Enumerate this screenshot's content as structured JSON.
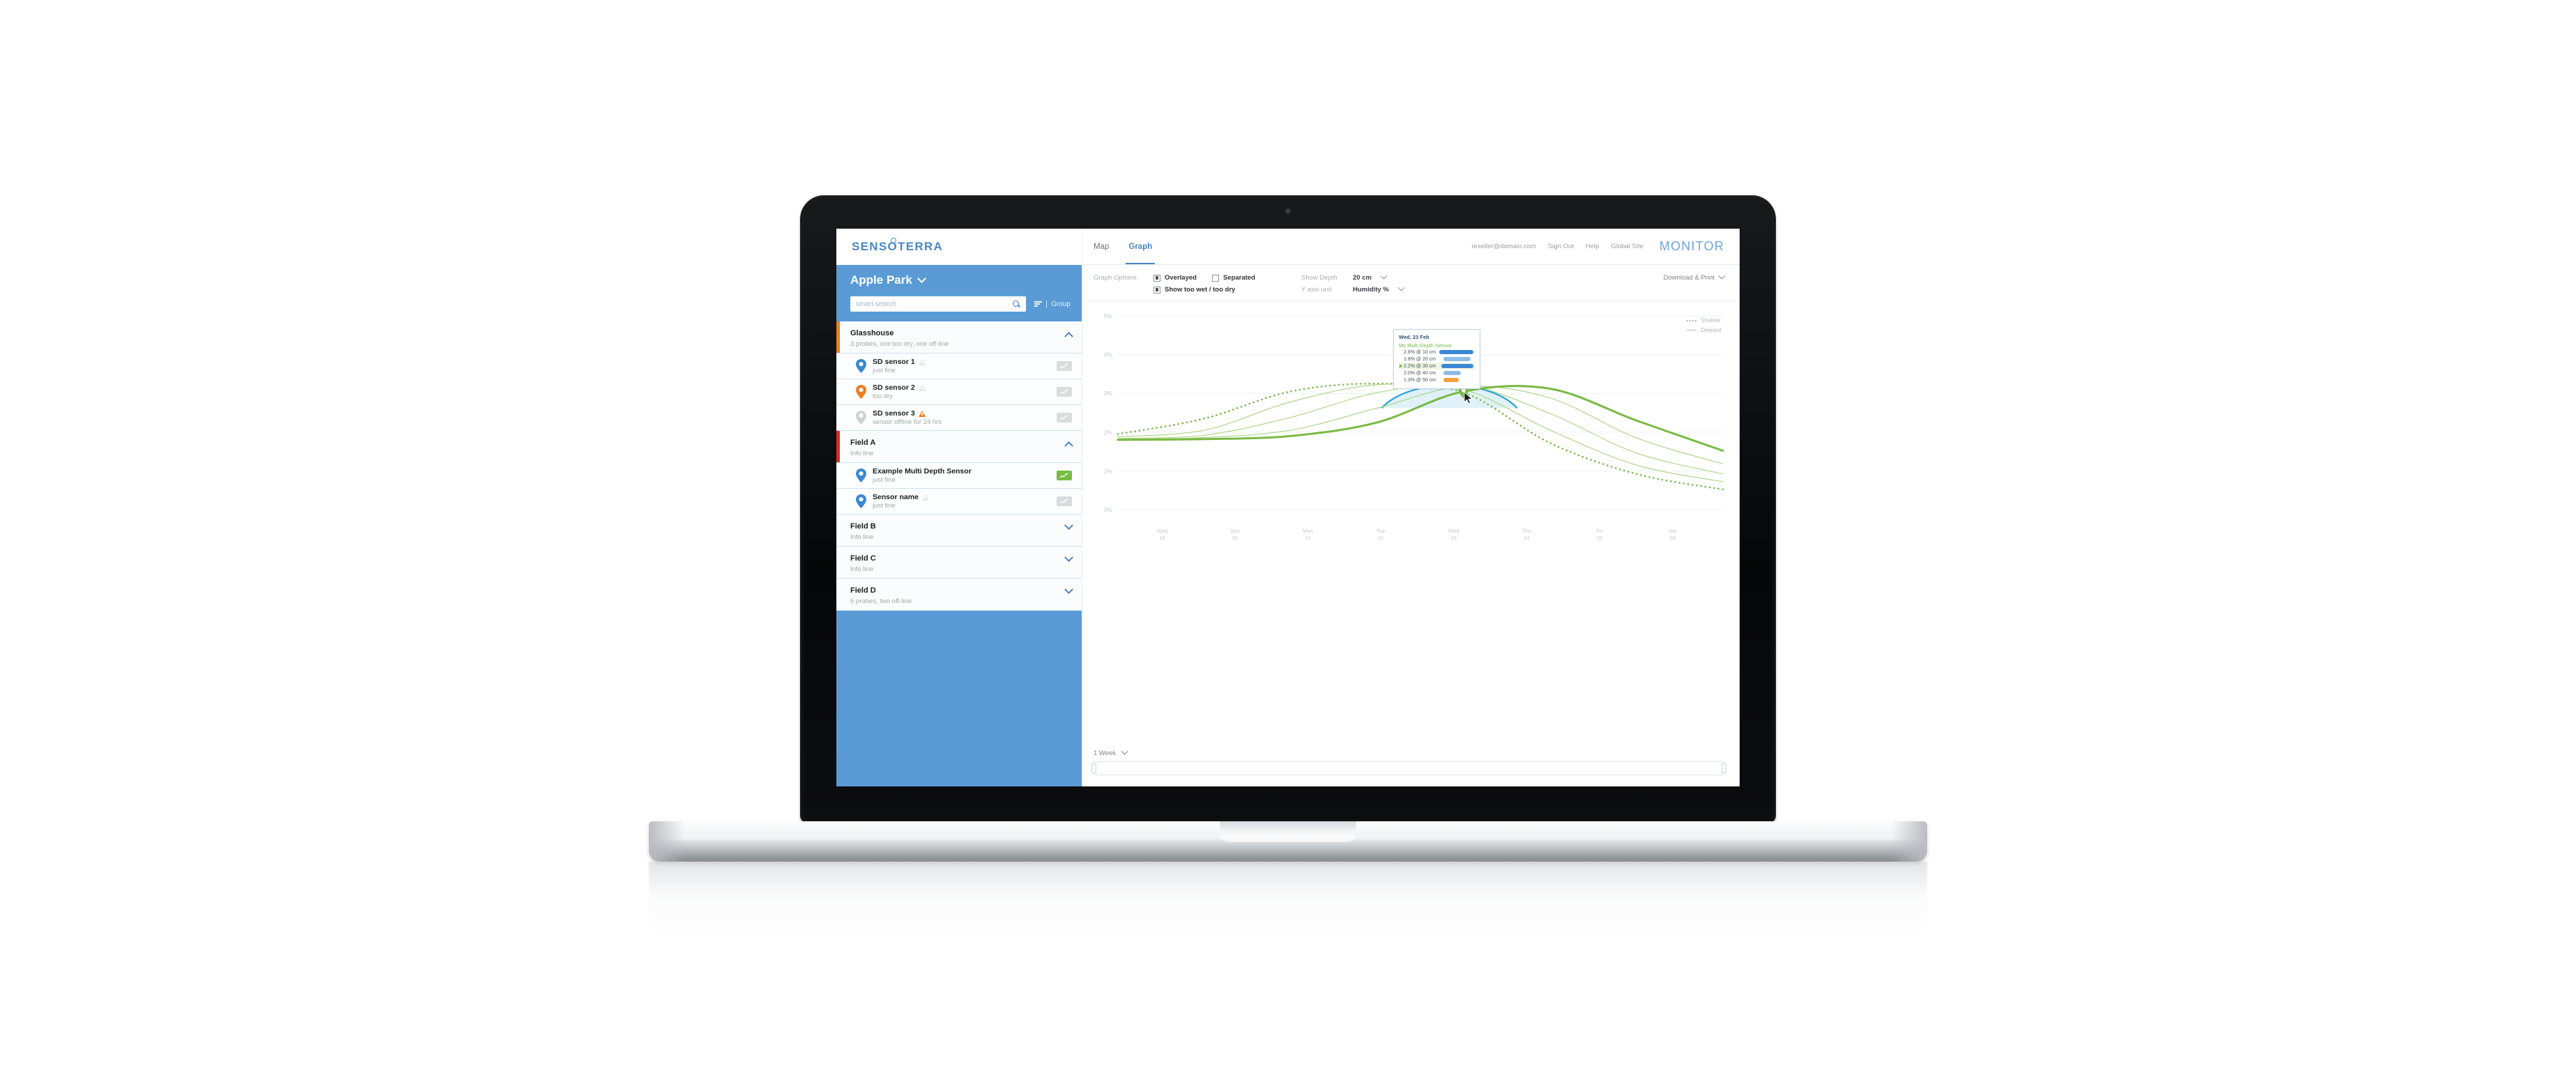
{
  "brand": {
    "name_part1": "SENS",
    "name_o": "O",
    "name_part2": "TERRA"
  },
  "sidebar": {
    "farm_title": "Apple Park",
    "search_placeholder": "smart search",
    "group_button": "Group",
    "groups": [
      {
        "name": "Glasshouse",
        "info": "3 probes, one too dry, one off-line",
        "expanded": true,
        "accent": "#f07d1e",
        "sensors": [
          {
            "name": "SD sensor 1",
            "status": "just fine",
            "pin_color": "#3b87d4",
            "warn": "muted",
            "badge": "inactive"
          },
          {
            "name": "SD sensor 2",
            "status": "too dry",
            "pin_color": "#f07d1e",
            "warn": "muted",
            "badge": "inactive"
          },
          {
            "name": "SD sensor 3",
            "status": "sensor offline for 24 hrs",
            "pin_color": "#cfd3d6",
            "warn": "alert",
            "badge": "inactive"
          }
        ]
      },
      {
        "name": "Field A",
        "info": "Info line",
        "expanded": true,
        "accent": "#e02b20",
        "sensors": [
          {
            "name": "Example Multi Depth Sensor",
            "status": "just fine",
            "pin_color": "#3b87d4",
            "warn": "none",
            "badge": "active"
          },
          {
            "name": "Sensor name",
            "status": "just fine",
            "pin_color": "#3b87d4",
            "warn": "muted",
            "badge": "inactive"
          }
        ]
      },
      {
        "name": "Field B",
        "info": "Info line",
        "expanded": false,
        "accent": "transparent",
        "sensors": []
      },
      {
        "name": "Field C",
        "info": "Info line",
        "expanded": false,
        "accent": "transparent",
        "sensors": []
      },
      {
        "name": "Field D",
        "info": "6 probes, two off-line",
        "expanded": false,
        "accent": "transparent",
        "sensors": []
      }
    ]
  },
  "topnav": {
    "tabs": [
      {
        "label": "Map",
        "active": false
      },
      {
        "label": "Graph",
        "active": true
      }
    ],
    "user_email": "reseller@domain.com",
    "sign_out": "Sign Out",
    "help": "Help",
    "global_site": "Global Site",
    "product": "MONITOR"
  },
  "options": {
    "graph_options_label": "Graph Options",
    "overlayed": "Overlayed",
    "separated": "Separated",
    "show_too_wet_too_dry": "Show too wet / too dry",
    "show_depth_label": "Show Depth",
    "show_depth_value": "20 cm",
    "y_axis_unit_label": "Y axis unit",
    "y_axis_unit_value": "Humidity %",
    "download_print": "Download & Print"
  },
  "chart_data": {
    "type": "line",
    "title": "",
    "xlabel": "",
    "ylabel": "Humidity %",
    "ylim": [
      0,
      5
    ],
    "grid": true,
    "legend_position": "right",
    "y_ticks": [
      "0%",
      "1%",
      "2%",
      "3%",
      "4%",
      "5%"
    ],
    "x": [
      "Wed 16",
      "Sun 20",
      "Mon 21",
      "Tue 22",
      "Wed 23",
      "Thu 24",
      "Fri 25",
      "Sat 26"
    ],
    "x_tick_days": [
      "Wed",
      "Sun",
      "Mon",
      "Tue",
      "Wed",
      "Thu",
      "Fri",
      "Sat"
    ],
    "x_tick_dates": [
      "16",
      "20",
      "21",
      "22",
      "23",
      "24",
      "25",
      "26"
    ],
    "legend": [
      {
        "name": "Shallow",
        "style": "dotted"
      },
      {
        "name": "Deepest",
        "style": "solid"
      }
    ],
    "series": [
      {
        "name": "10 cm",
        "style": "dotted",
        "color": "#7ab648",
        "width": 2.6,
        "values": [
          1.95,
          2.35,
          3.05,
          3.25,
          3.02,
          1.72,
          0.92,
          0.52
        ]
      },
      {
        "name": "20 cm",
        "style": "solid",
        "color": "#a9d47f",
        "width": 1.1,
        "values": [
          1.88,
          2.05,
          2.78,
          3.22,
          3.1,
          2.05,
          1.15,
          0.72
        ]
      },
      {
        "name": "30 cm",
        "style": "solid",
        "color": "#a9d47f",
        "width": 1.1,
        "values": [
          1.84,
          1.92,
          2.38,
          3.02,
          3.22,
          2.48,
          1.46,
          0.92
        ]
      },
      {
        "name": "40 cm",
        "style": "solid",
        "color": "#a9d47f",
        "width": 1.1,
        "values": [
          1.82,
          1.86,
          2.05,
          2.62,
          3.18,
          2.88,
          1.85,
          1.18
        ]
      },
      {
        "name": "50 cm",
        "style": "solid",
        "color": "#79b943",
        "width": 3.0,
        "values": [
          1.8,
          1.82,
          1.9,
          2.25,
          3.05,
          3.12,
          2.3,
          1.52
        ]
      }
    ],
    "band": {
      "label": "too wet / too dry band",
      "fill": "#cfe9f7",
      "stroke": "#2aa4d6"
    },
    "marker": {
      "color": "#76bc43",
      "x_label": "Wed 23"
    }
  },
  "tooltip": {
    "date": "Wed, 23 Feb",
    "sensor": "My Multi Depth Sensor",
    "rows": [
      {
        "value": "2.6% @ 10 cm",
        "bar_pct": 100,
        "color": "#3b87d4",
        "selected": false
      },
      {
        "value": "1.8% @ 20 cm",
        "bar_pct": 70,
        "color": "#8ebbe6",
        "selected": false
      },
      {
        "value": "2.2% @ 30 cm",
        "bar_pct": 88,
        "color": "#3b87d4",
        "selected": true
      },
      {
        "value": "2.0% @ 40 cm",
        "bar_pct": 45,
        "color": "#8ebbe6",
        "selected": false
      },
      {
        "value": "1.3% @ 50 cm",
        "bar_pct": 40,
        "color": "#f5a03c",
        "selected": false
      }
    ]
  },
  "range": {
    "selected": "1 Week"
  }
}
